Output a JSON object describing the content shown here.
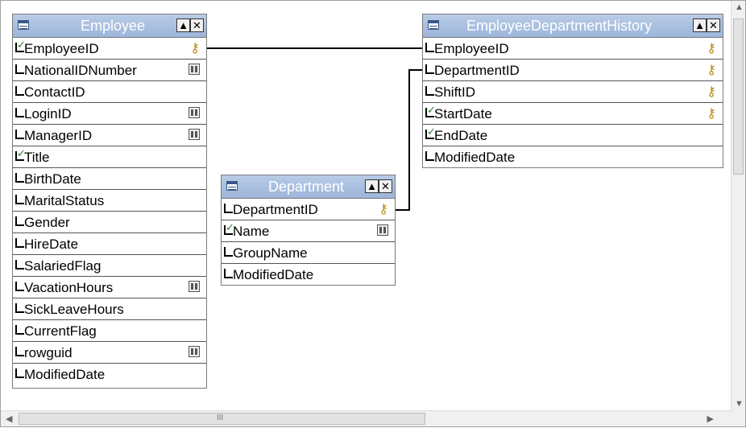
{
  "tables": {
    "employee": {
      "title": "Employee",
      "columns": [
        {
          "name": "EmployeeID",
          "checked": true,
          "icon": "key-icon"
        },
        {
          "name": "NationalIDNumber",
          "checked": false,
          "icon": "fulltext-icon"
        },
        {
          "name": "ContactID",
          "checked": false,
          "icon": ""
        },
        {
          "name": "LoginID",
          "checked": false,
          "icon": "fulltext-icon"
        },
        {
          "name": "ManagerID",
          "checked": false,
          "icon": "fulltext-icon"
        },
        {
          "name": "Title",
          "checked": true,
          "icon": ""
        },
        {
          "name": "BirthDate",
          "checked": false,
          "icon": ""
        },
        {
          "name": "MaritalStatus",
          "checked": false,
          "icon": ""
        },
        {
          "name": "Gender",
          "checked": false,
          "icon": ""
        },
        {
          "name": "HireDate",
          "checked": false,
          "icon": ""
        },
        {
          "name": "SalariedFlag",
          "checked": false,
          "icon": ""
        },
        {
          "name": "VacationHours",
          "checked": false,
          "icon": "fulltext-icon"
        },
        {
          "name": "SickLeaveHours",
          "checked": false,
          "icon": ""
        },
        {
          "name": "CurrentFlag",
          "checked": false,
          "icon": ""
        },
        {
          "name": "rowguid",
          "checked": false,
          "icon": "fulltext-icon"
        },
        {
          "name": "ModifiedDate",
          "checked": false,
          "icon": ""
        }
      ]
    },
    "department": {
      "title": "Department",
      "columns": [
        {
          "name": "DepartmentID",
          "checked": false,
          "icon": "key-icon"
        },
        {
          "name": "Name",
          "checked": true,
          "icon": "fulltext-icon"
        },
        {
          "name": "GroupName",
          "checked": false,
          "icon": ""
        },
        {
          "name": "ModifiedDate",
          "checked": false,
          "icon": ""
        }
      ]
    },
    "history": {
      "title": "EmployeeDepartmentHistory",
      "columns": [
        {
          "name": "EmployeeID",
          "checked": false,
          "icon": "key-icon"
        },
        {
          "name": "DepartmentID",
          "checked": false,
          "icon": "key-icon"
        },
        {
          "name": "ShiftID",
          "checked": false,
          "icon": "key-icon"
        },
        {
          "name": "StartDate",
          "checked": true,
          "icon": "key-icon"
        },
        {
          "name": "EndDate",
          "checked": true,
          "icon": ""
        },
        {
          "name": "ModifiedDate",
          "checked": false,
          "icon": ""
        }
      ]
    }
  },
  "title_buttons": {
    "autosize": "▲",
    "close": "✕"
  },
  "scrollbar": {
    "h_grip": "III"
  }
}
